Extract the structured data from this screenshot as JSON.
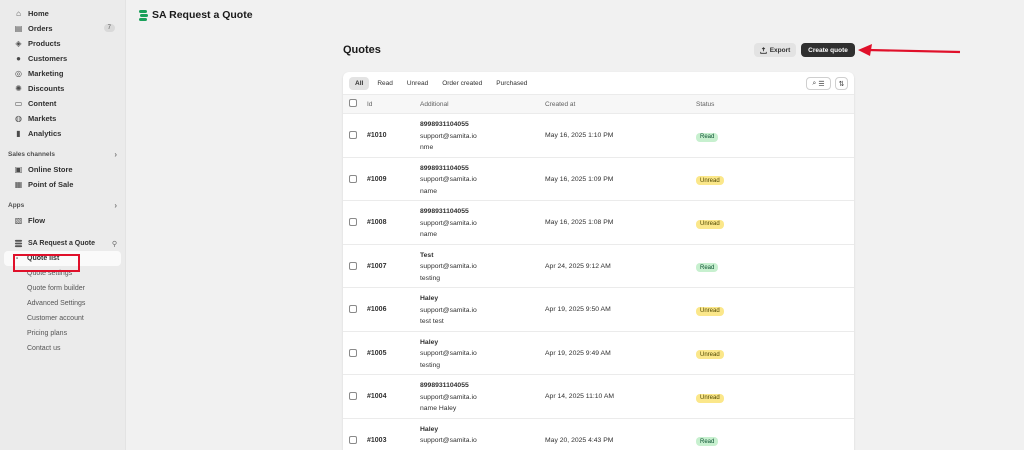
{
  "sidebar": {
    "main_items": [
      {
        "label": "Home",
        "icon": "home-icon"
      },
      {
        "label": "Orders",
        "icon": "orders-icon",
        "badge": "7"
      },
      {
        "label": "Products",
        "icon": "products-icon"
      },
      {
        "label": "Customers",
        "icon": "customers-icon"
      },
      {
        "label": "Marketing",
        "icon": "marketing-icon"
      },
      {
        "label": "Discounts",
        "icon": "discounts-icon"
      },
      {
        "label": "Content",
        "icon": "content-icon"
      },
      {
        "label": "Markets",
        "icon": "markets-icon"
      },
      {
        "label": "Analytics",
        "icon": "analytics-icon"
      }
    ],
    "sales_channels_label": "Sales channels",
    "sales_channels": [
      {
        "label": "Online Store",
        "icon": "online-store-icon"
      },
      {
        "label": "Point of Sale",
        "icon": "pos-icon"
      }
    ],
    "apps_label": "Apps",
    "apps": [
      {
        "label": "Flow",
        "icon": "flow-icon"
      }
    ],
    "app_name": "SA Request a Quote",
    "app_subitems": [
      "Quote list",
      "Quote settings",
      "Quote form builder",
      "Advanced Settings",
      "Customer account",
      "Pricing plans",
      "Contact us"
    ],
    "active_subitem": 0
  },
  "header": {
    "app_title": "SA Request a Quote"
  },
  "main": {
    "title": "Quotes",
    "export_label": "Export",
    "create_label": "Create quote",
    "tabs": [
      "All",
      "Read",
      "Unread",
      "Order created",
      "Purchased"
    ],
    "columns": {
      "id": "Id",
      "additional": "Additional",
      "created": "Created at",
      "status": "Status"
    },
    "rows": [
      {
        "id": "#1010",
        "name": "8998931104055",
        "email": "support@samita.io",
        "note": "nme",
        "date": "May 16, 2025 1:10 PM",
        "status": "Read"
      },
      {
        "id": "#1009",
        "name": "8998931104055",
        "email": "support@samita.io",
        "note": "name",
        "date": "May 16, 2025 1:09 PM",
        "status": "Unread"
      },
      {
        "id": "#1008",
        "name": "8998931104055",
        "email": "support@samita.io",
        "note": "name",
        "date": "May 16, 2025 1:08 PM",
        "status": "Unread"
      },
      {
        "id": "#1007",
        "name": "Test",
        "email": "support@samita.io",
        "note": "testing",
        "date": "Apr 24, 2025 9:12 AM",
        "status": "Read"
      },
      {
        "id": "#1006",
        "name": "Haley",
        "email": "support@samita.io",
        "note": "test test",
        "date": "Apr 19, 2025 9:50 AM",
        "status": "Unread"
      },
      {
        "id": "#1005",
        "name": "Haley",
        "email": "support@samita.io",
        "note": "testing",
        "date": "Apr 19, 2025 9:49 AM",
        "status": "Unread"
      },
      {
        "id": "#1004",
        "name": "8998931104055",
        "email": "support@samita.io",
        "note": "name Haley",
        "date": "Apr 14, 2025 11:10 AM",
        "status": "Unread"
      },
      {
        "id": "#1003",
        "name": "Haley",
        "email": "support@samita.io",
        "note": "",
        "date": "May 20, 2025 4:43 PM",
        "status": "Read"
      }
    ]
  },
  "colors": {
    "read_bg": "#c7f0cf",
    "unread_bg": "#fbe78a",
    "annotation": "#e0102a",
    "brand": "#1aa05a"
  }
}
